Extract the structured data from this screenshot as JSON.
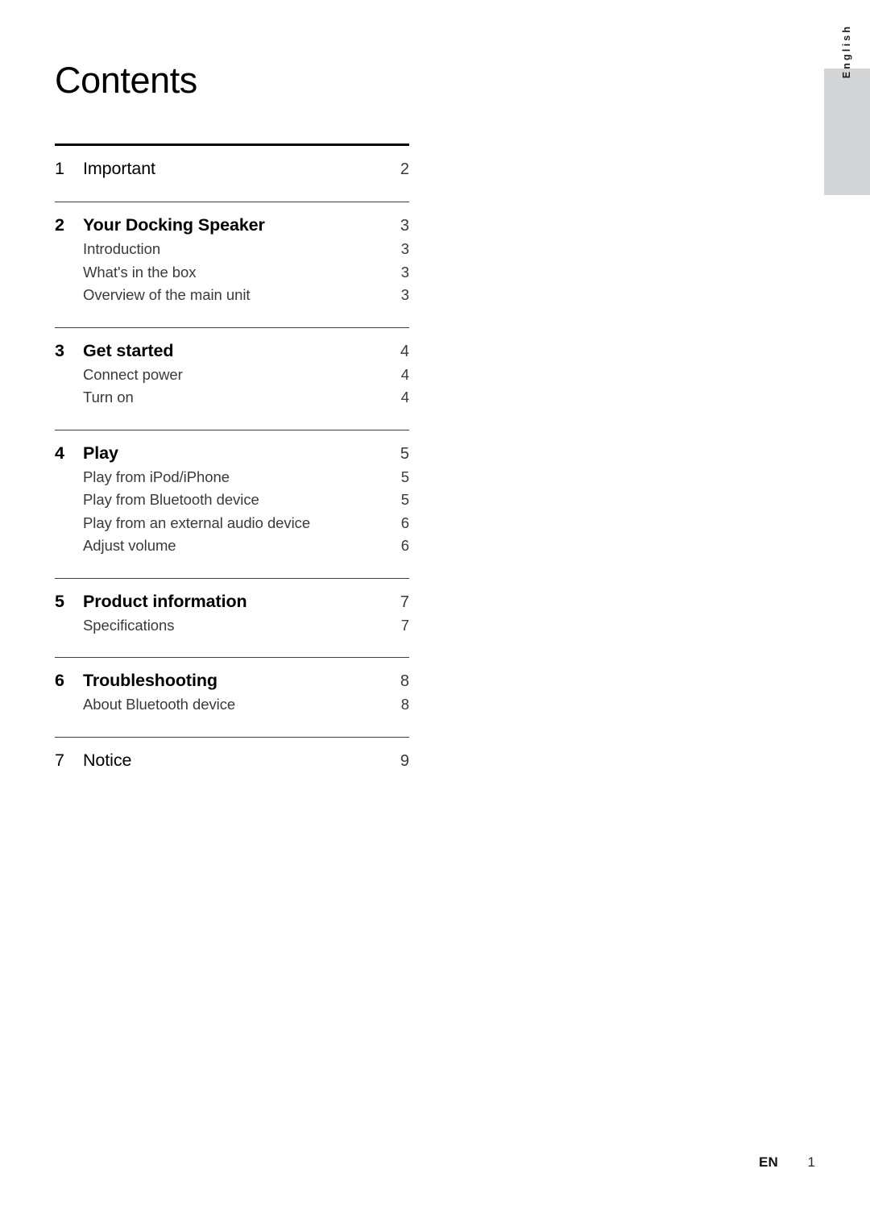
{
  "page_title": "Contents",
  "language_tab": {
    "label": "English",
    "background_color": "#d3d5d7"
  },
  "toc": {
    "groups": [
      {
        "rule": "thick",
        "chapter": {
          "number": "1",
          "title": "Important",
          "page": "2",
          "weight": "light"
        },
        "sub_entries": []
      },
      {
        "rule": "thin",
        "chapter": {
          "number": "2",
          "title": "Your Docking Speaker",
          "page": "3",
          "weight": "bold"
        },
        "sub_entries": [
          {
            "title": "Introduction",
            "page": "3"
          },
          {
            "title": "What's in the box",
            "page": "3"
          },
          {
            "title": "Overview of the main unit",
            "page": "3"
          }
        ]
      },
      {
        "rule": "thin",
        "chapter": {
          "number": "3",
          "title": "Get started",
          "page": "4",
          "weight": "bold"
        },
        "sub_entries": [
          {
            "title": "Connect power",
            "page": "4"
          },
          {
            "title": "Turn on",
            "page": "4"
          }
        ]
      },
      {
        "rule": "thin",
        "chapter": {
          "number": "4",
          "title": "Play",
          "page": "5",
          "weight": "bold"
        },
        "sub_entries": [
          {
            "title": "Play from iPod/iPhone",
            "page": "5"
          },
          {
            "title": "Play from Bluetooth device",
            "page": "5"
          },
          {
            "title": "Play from an external audio device",
            "page": "6"
          },
          {
            "title": "Adjust volume",
            "page": "6"
          }
        ]
      },
      {
        "rule": "thin",
        "chapter": {
          "number": "5",
          "title": "Product information",
          "page": "7",
          "weight": "bold"
        },
        "sub_entries": [
          {
            "title": "Specifications",
            "page": "7"
          }
        ]
      },
      {
        "rule": "thin",
        "chapter": {
          "number": "6",
          "title": "Troubleshooting",
          "page": "8",
          "weight": "bold"
        },
        "sub_entries": [
          {
            "title": "About Bluetooth device",
            "page": "8"
          }
        ]
      },
      {
        "rule": "thin",
        "chapter": {
          "number": "7",
          "title": "Notice",
          "page": "9",
          "weight": "light"
        },
        "sub_entries": []
      }
    ]
  },
  "footer": {
    "language_code": "EN",
    "page_number": "1"
  }
}
